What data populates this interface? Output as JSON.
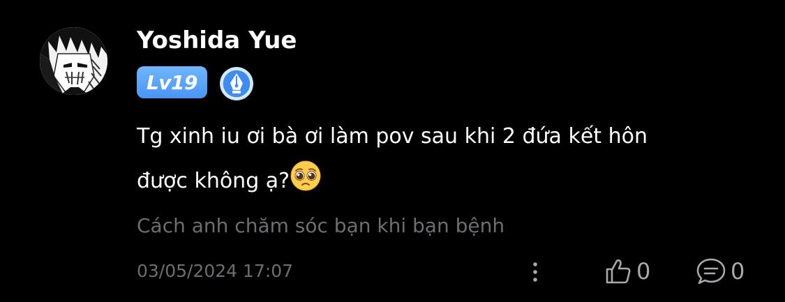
{
  "comment": {
    "user": {
      "name": "Yoshida Yue",
      "level": "Lv19",
      "avatar_icon": "anime-character-avatar",
      "badge_icon": "pen-nib-author-badge-icon"
    },
    "text_line_1": "Tg xinh iu ơi bà ơi làm pov sau khi 2 đứa kết hôn",
    "text_line_2": "được không ạ?",
    "emoji": "pleading-face-emoji",
    "reply_reference": "Cách anh chăm sóc bạn khi bạn bệnh",
    "timestamp": "03/05/2024 17:07",
    "likes": "0",
    "replies": "0"
  },
  "colors": {
    "background": "#000000",
    "text_primary": "#ffffff",
    "text_secondary": "#6e6e72",
    "level_badge": "#5aa5fa",
    "icon_gray": "#a8a8ad"
  }
}
